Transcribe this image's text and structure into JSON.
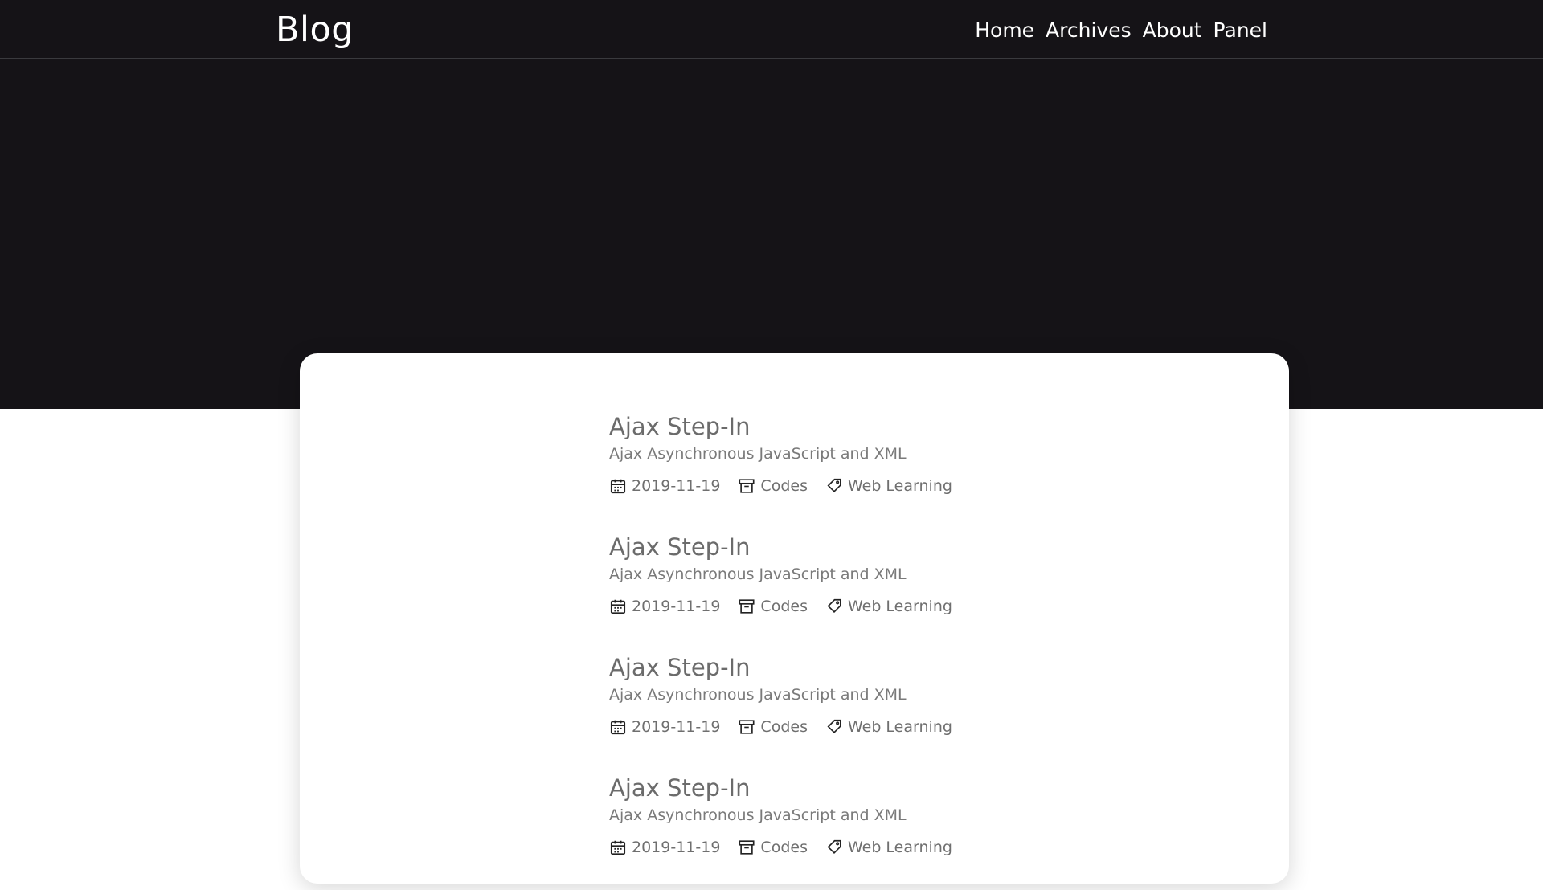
{
  "site": {
    "brand": "Blog"
  },
  "nav": {
    "items": [
      {
        "label": "Home"
      },
      {
        "label": "Archives"
      },
      {
        "label": "About"
      },
      {
        "label": "Panel"
      }
    ]
  },
  "posts": [
    {
      "title": "Ajax Step-In",
      "summary": "Ajax Asynchronous JavaScript and XML",
      "date": "2019-11-19",
      "category": "Codes",
      "tag": "Web Learning"
    },
    {
      "title": "Ajax Step-In",
      "summary": "Ajax Asynchronous JavaScript and XML",
      "date": "2019-11-19",
      "category": "Codes",
      "tag": "Web Learning"
    },
    {
      "title": "Ajax Step-In",
      "summary": "Ajax Asynchronous JavaScript and XML",
      "date": "2019-11-19",
      "category": "Codes",
      "tag": "Web Learning"
    },
    {
      "title": "Ajax Step-In",
      "summary": "Ajax Asynchronous JavaScript and XML",
      "date": "2019-11-19",
      "category": "Codes",
      "tag": "Web Learning"
    }
  ],
  "icons": {
    "date": "calendar-icon",
    "category": "archive-box-icon",
    "tag": "tag-icon"
  },
  "colors": {
    "header_bg": "#151317",
    "text_muted": "#6b6b6b",
    "page_bg": "#ffffff"
  }
}
